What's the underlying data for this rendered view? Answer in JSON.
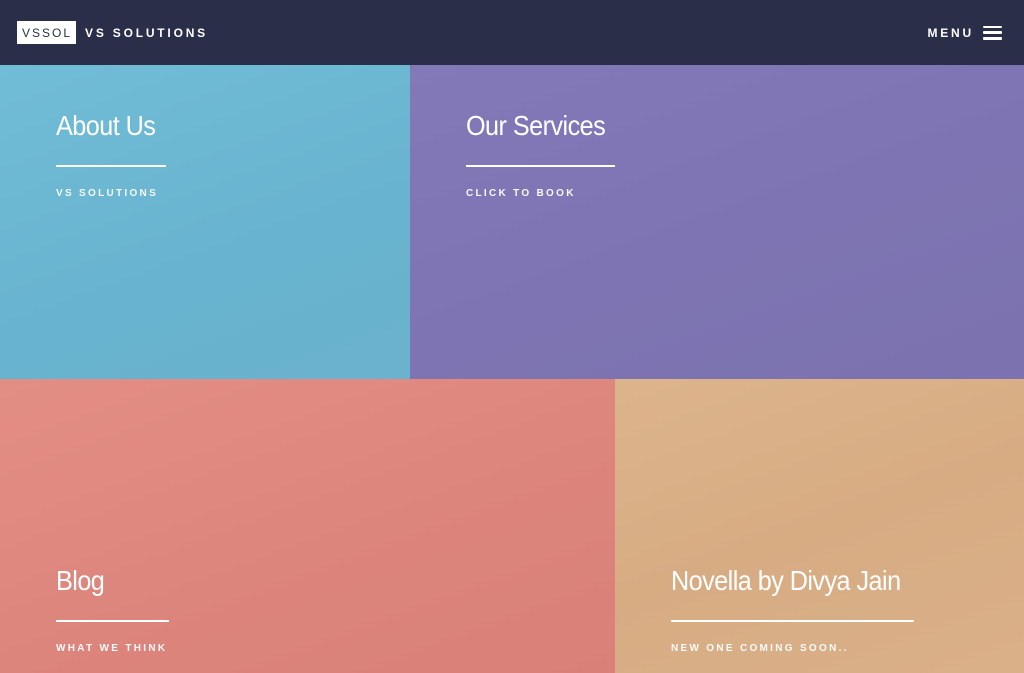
{
  "header": {
    "logo_text": "VSSOL",
    "brand_name": "VS SOLUTIONS",
    "menu_label": "MENU",
    "menu_icon": "hamburger-icon",
    "background": "#2b2e48"
  },
  "tiles": [
    {
      "title": "About Us",
      "subtitle": "VS SOLUTIONS",
      "color": "#6cb6d1"
    },
    {
      "title": "Our Services",
      "subtitle": "CLICK TO BOOK",
      "color": "#7f76b4"
    },
    {
      "title": "Blog",
      "subtitle": "WHAT WE THINK",
      "color": "#dd877f"
    },
    {
      "title": "Novella by Divya Jain",
      "subtitle": "NEW ONE COMING SOON..",
      "color": "#d8af86"
    }
  ]
}
